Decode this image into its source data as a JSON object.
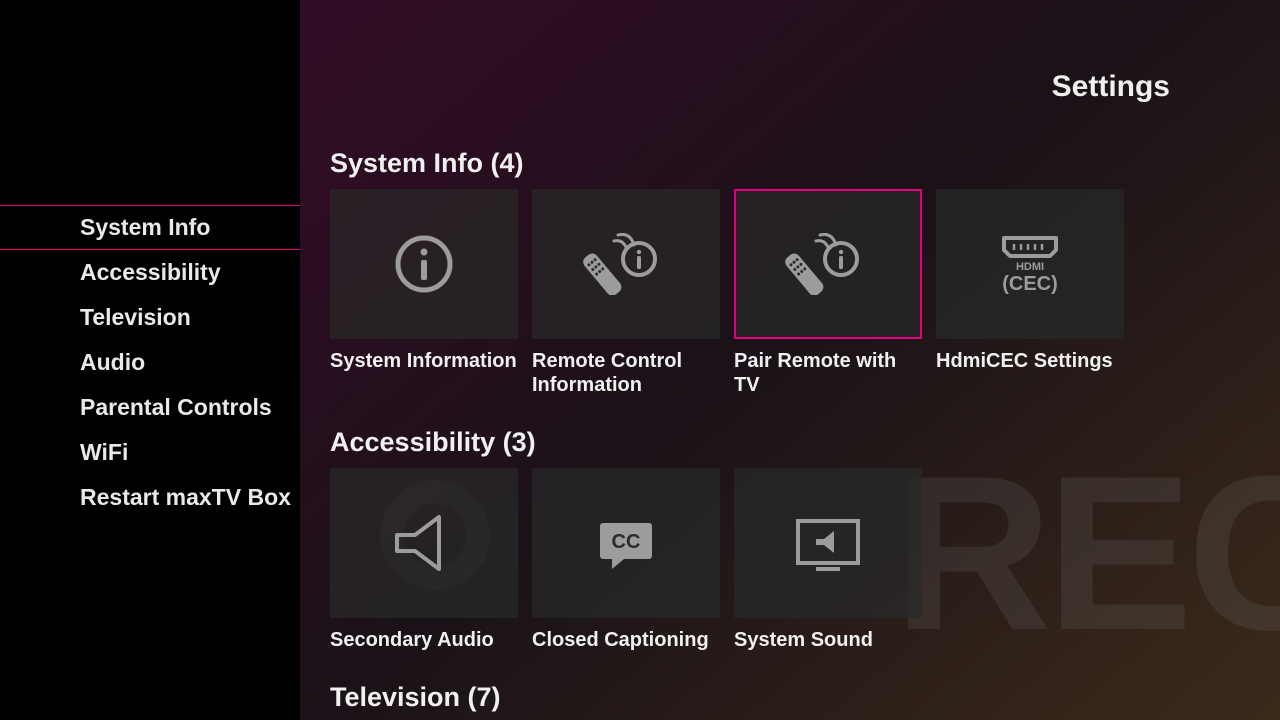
{
  "page": {
    "title": "Settings"
  },
  "sidebar": {
    "items": [
      {
        "label": "System Info",
        "selected": true
      },
      {
        "label": "Accessibility",
        "selected": false
      },
      {
        "label": "Television",
        "selected": false
      },
      {
        "label": "Audio",
        "selected": false
      },
      {
        "label": "Parental Controls",
        "selected": false
      },
      {
        "label": "WiFi",
        "selected": false
      },
      {
        "label": "Restart maxTV Box",
        "selected": false
      }
    ]
  },
  "sections": [
    {
      "title": "System Info (4)",
      "tiles": [
        {
          "label": "System Information",
          "icon": "info",
          "selected": false
        },
        {
          "label": "Remote Control Information",
          "icon": "remote-info",
          "selected": false
        },
        {
          "label": "Pair Remote with TV",
          "icon": "remote-info",
          "selected": true
        },
        {
          "label": "HdmiCEC Settings",
          "icon": "hdmi-cec",
          "selected": false
        }
      ]
    },
    {
      "title": "Accessibility (3)",
      "tiles": [
        {
          "label": "Secondary Audio",
          "icon": "speaker-outline",
          "selected": false
        },
        {
          "label": "Closed Captioning",
          "icon": "cc",
          "selected": false
        },
        {
          "label": "System Sound",
          "icon": "tv-speaker",
          "selected": false
        }
      ]
    },
    {
      "title": "Television (7)",
      "tiles": []
    }
  ],
  "watermark": "REC"
}
